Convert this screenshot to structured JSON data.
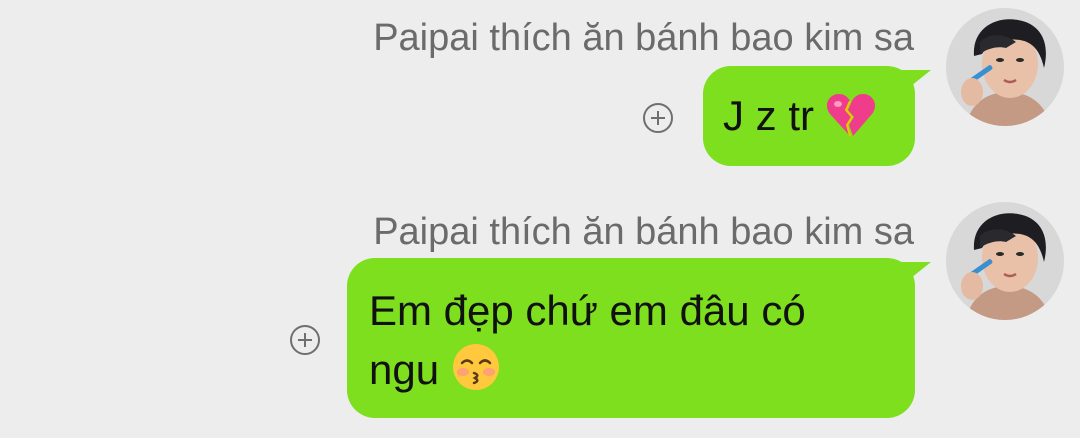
{
  "conversation": {
    "messages": [
      {
        "sender": "Paipai thích ăn bánh bao kim sa",
        "text": "J z tr",
        "emoji_icon": "broken-heart-icon"
      },
      {
        "sender": "Paipai thích ăn bánh bao kim sa",
        "text_line1": "Em đẹp chứ em đâu có",
        "text_line2": "ngu",
        "emoji_icon": "kissing-smiling-eyes-icon"
      }
    ]
  },
  "colors": {
    "background": "#ededed",
    "bubble": "#7ddf1d",
    "sender_name": "#6b6b6b",
    "text": "#111111"
  }
}
